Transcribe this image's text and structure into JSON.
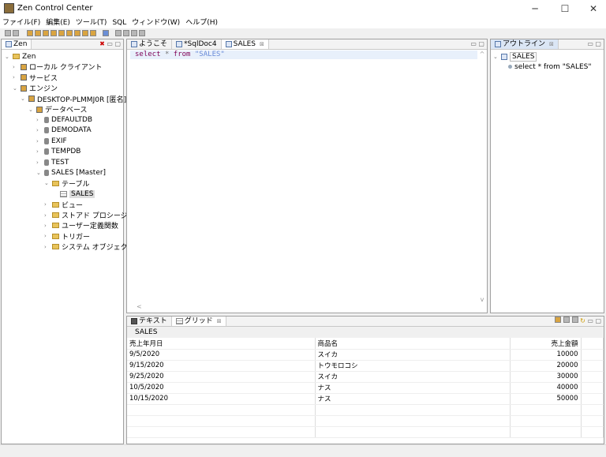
{
  "window": {
    "title": "Zen Control Center",
    "minimize": "─",
    "maximize": "☐",
    "close": "✕"
  },
  "menu": [
    "ファイル(F)",
    "編集(E)",
    "ツール(T)",
    "SQL",
    "ウィンドウ(W)",
    "ヘルプ(H)"
  ],
  "explorer": {
    "tab": "Zen",
    "tree": [
      {
        "label": "Zen",
        "level": 0,
        "arrow": "⌄",
        "icon": "folder"
      },
      {
        "label": "ローカル クライアント",
        "level": 1,
        "arrow": "›",
        "icon": "srv"
      },
      {
        "label": "サービス",
        "level": 1,
        "arrow": "›",
        "icon": "srv"
      },
      {
        "label": "エンジン",
        "level": 1,
        "arrow": "⌄",
        "icon": "srv"
      },
      {
        "label": "DESKTOP-PLMMJ0R [匿名]",
        "level": 2,
        "arrow": "⌄",
        "icon": "srv"
      },
      {
        "label": "データベース",
        "level": 3,
        "arrow": "⌄",
        "icon": "srv"
      },
      {
        "label": "DEFAULTDB",
        "level": 4,
        "arrow": "›",
        "icon": "db"
      },
      {
        "label": "DEMODATA",
        "level": 4,
        "arrow": "›",
        "icon": "db"
      },
      {
        "label": "EXIF",
        "level": 4,
        "arrow": "›",
        "icon": "db"
      },
      {
        "label": "TEMPDB",
        "level": 4,
        "arrow": "›",
        "icon": "db"
      },
      {
        "label": "TEST",
        "level": 4,
        "arrow": "›",
        "icon": "db"
      },
      {
        "label": "SALES [Master]",
        "level": 4,
        "arrow": "⌄",
        "icon": "db"
      },
      {
        "label": "テーブル",
        "level": 5,
        "arrow": "⌄",
        "icon": "folder"
      },
      {
        "label": "SALES",
        "level": 6,
        "arrow": "",
        "icon": "tbl",
        "selected": true
      },
      {
        "label": "ビュー",
        "level": 5,
        "arrow": "›",
        "icon": "folder"
      },
      {
        "label": "ストアド プロシージャ",
        "level": 5,
        "arrow": "›",
        "icon": "folder"
      },
      {
        "label": "ユーザー定義関数",
        "level": 5,
        "arrow": "›",
        "icon": "folder"
      },
      {
        "label": "トリガー",
        "level": 5,
        "arrow": "›",
        "icon": "folder"
      },
      {
        "label": "システム オブジェクト",
        "level": 5,
        "arrow": "›",
        "icon": "folder"
      }
    ]
  },
  "editor": {
    "tabs": [
      "ようこそ",
      "*SqlDoc4",
      "SALES"
    ],
    "active_tab": "SALES",
    "code": {
      "kw1": "select",
      "star": "*",
      "kw2": "from",
      "str": "\"SALES\""
    }
  },
  "outline": {
    "tab": "アウトライン",
    "root": "SALES",
    "child": "select * from \"SALES\""
  },
  "results": {
    "tabs": [
      "テキスト",
      "グリッド"
    ],
    "active_tab": "グリッド",
    "table_name": "SALES",
    "columns": [
      "売上年月日",
      "商品名",
      "売上金額"
    ],
    "rows": [
      [
        "9/5/2020",
        "スイカ",
        "10000"
      ],
      [
        "9/15/2020",
        "トウモロコシ",
        "20000"
      ],
      [
        "9/25/2020",
        "スイカ",
        "30000"
      ],
      [
        "10/5/2020",
        "ナス",
        "40000"
      ],
      [
        "10/15/2020",
        "ナス",
        "50000"
      ]
    ]
  }
}
